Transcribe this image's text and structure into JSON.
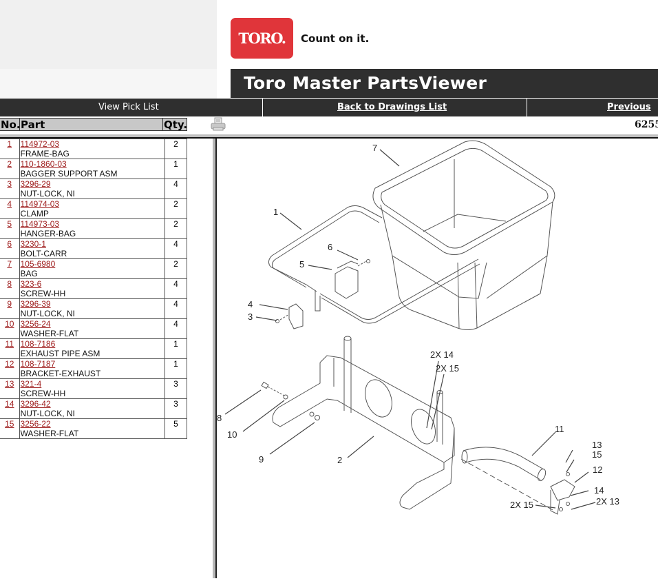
{
  "header": {
    "logo_text": "TORO.",
    "tagline": "Count on it.",
    "title": "Toro Master PartsViewer",
    "brand_color": "#e0353a"
  },
  "nav": {
    "view_pick_list": "View Pick List",
    "back_to_drawings": "Back to Drawings List",
    "previous": "Previous"
  },
  "table_header": {
    "no": "No.",
    "part": "Part",
    "qty": "Qty."
  },
  "figure_number": "6255",
  "parts": [
    {
      "no": "1",
      "part_number": "114972-03",
      "description": "FRAME-BAG",
      "qty": "2"
    },
    {
      "no": "2",
      "part_number": "110-1860-03",
      "description": "BAGGER SUPPORT ASM",
      "qty": "1"
    },
    {
      "no": "3",
      "part_number": "3296-29",
      "description": "NUT-LOCK, NI",
      "qty": "4"
    },
    {
      "no": "4",
      "part_number": "114974-03",
      "description": "CLAMP",
      "qty": "2"
    },
    {
      "no": "5",
      "part_number": "114973-03",
      "description": "HANGER-BAG",
      "qty": "2"
    },
    {
      "no": "6",
      "part_number": "3230-1",
      "description": "BOLT-CARR",
      "qty": "4"
    },
    {
      "no": "7",
      "part_number": "105-6980",
      "description": "BAG",
      "qty": "2"
    },
    {
      "no": "8",
      "part_number": "323-6",
      "description": "SCREW-HH",
      "qty": "4"
    },
    {
      "no": "9",
      "part_number": "3296-39",
      "description": "NUT-LOCK, NI",
      "qty": "4"
    },
    {
      "no": "10",
      "part_number": "3256-24",
      "description": "WASHER-FLAT",
      "qty": "4"
    },
    {
      "no": "11",
      "part_number": "108-7186",
      "description": "EXHAUST PIPE ASM",
      "qty": "1"
    },
    {
      "no": "12",
      "part_number": "108-7187",
      "description": "BRACKET-EXHAUST",
      "qty": "1"
    },
    {
      "no": "13",
      "part_number": "321-4",
      "description": "SCREW-HH",
      "qty": "3"
    },
    {
      "no": "14",
      "part_number": "3296-42",
      "description": "NUT-LOCK, NI",
      "qty": "3"
    },
    {
      "no": "15",
      "part_number": "3256-22",
      "description": "WASHER-FLAT",
      "qty": "5"
    }
  ],
  "diagram": {
    "callouts": [
      "7",
      "1",
      "6",
      "5",
      "4",
      "3",
      "2X 14",
      "2X 15",
      "8",
      "10",
      "9",
      "2",
      "11",
      "13",
      "15",
      "12",
      "14",
      "2X 15",
      "2X 13"
    ]
  }
}
